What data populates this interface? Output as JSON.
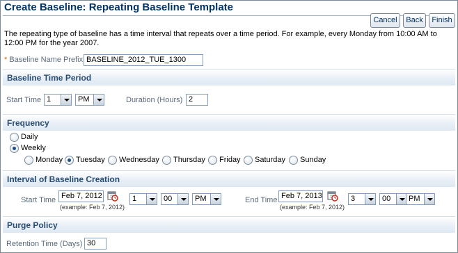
{
  "page": {
    "title": "Create Baseline: Repeating Baseline Template",
    "buttons": {
      "cancel": "Cancel",
      "back": "Back",
      "finish": "Finish"
    },
    "description": "The repeating type of baseline has a time interval that repeats over a time period. For example, every Monday from 10:00 AM to 12:00 PM for the year 2007."
  },
  "prefix": {
    "required_mark": "*",
    "label": "Baseline Name Prefix",
    "value": "BASELINE_2012_TUE_1300"
  },
  "time_period": {
    "heading": "Baseline Time Period",
    "start_time_label": "Start Time",
    "hour": "1",
    "ampm": "PM",
    "duration_label": "Duration (Hours)",
    "duration_value": "2"
  },
  "frequency": {
    "heading": "Frequency",
    "options": [
      "Daily",
      "Weekly"
    ],
    "selected": "Weekly",
    "days": [
      "Monday",
      "Tuesday",
      "Wednesday",
      "Thursday",
      "Friday",
      "Saturday",
      "Sunday"
    ],
    "selected_day": "Tuesday"
  },
  "interval": {
    "heading": "Interval of Baseline Creation",
    "start": {
      "label": "Start Time",
      "date": "Feb 7, 2012",
      "example": "(example: Feb 7, 2012)",
      "hour": "1",
      "minute": "00",
      "ampm": "PM"
    },
    "end": {
      "label": "End Time",
      "date": "Feb 7, 2013",
      "example": "(example: Feb 7, 2012)",
      "hour": "3",
      "minute": "00",
      "ampm": "PM"
    }
  },
  "purge": {
    "heading": "Purge Policy",
    "retention_label": "Retention Time (Days)",
    "retention_value": "30"
  },
  "icons": {
    "calendar": "calendar-icon",
    "dropdown": "chevron-down-icon"
  },
  "colors": {
    "title": "#003366",
    "section_heading": "#294d72",
    "label": "#5a6b7c",
    "required": "#cc6600",
    "selected_radio": "#1b4f85"
  }
}
